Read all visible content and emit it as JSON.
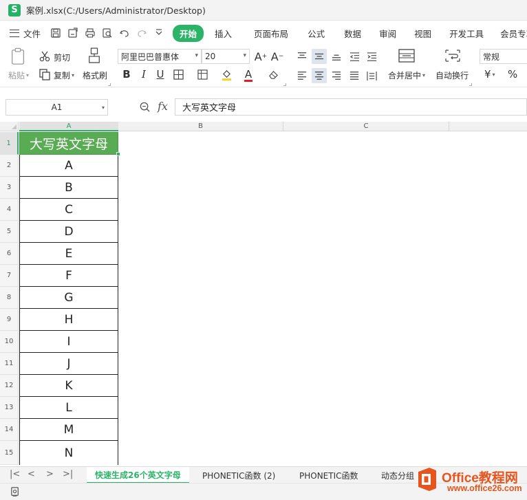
{
  "window": {
    "app_logo": "S",
    "title": "案例.xlsx(C:/Users/Administrator/Desktop)"
  },
  "menu": {
    "file_label": "文件",
    "quick_access_icons": [
      "save-icon",
      "save-as-icon",
      "print-icon",
      "print-preview-icon",
      "undo-icon",
      "redo-icon",
      "more-icon"
    ],
    "tabs": [
      "开始",
      "插入",
      "页面布局",
      "公式",
      "数据",
      "审阅",
      "视图",
      "开发工具",
      "会员专享"
    ],
    "active_tab": "开始"
  },
  "ribbon": {
    "paste_label": "粘贴",
    "cut_label": "剪切",
    "copy_label": "复制",
    "format_painter_label": "格式刷",
    "font_name": "阿里巴巴普惠体",
    "font_size": "20",
    "merge_center_label": "合并居中",
    "wrap_text_label": "自动换行",
    "number_format": "常规",
    "currency_symbol": "¥",
    "percent_symbol": "%",
    "bold": "B",
    "italic": "I",
    "underline": "U",
    "font_color_letter": "A",
    "increase_font": "A⁺",
    "decrease_font": "A⁻"
  },
  "formula_bar": {
    "cell_ref": "A1",
    "fx": "fx",
    "content": "大写英文字母"
  },
  "grid": {
    "columns": [
      "A",
      "B",
      "C"
    ],
    "rows": [
      "1",
      "2",
      "3",
      "4",
      "5",
      "6",
      "7",
      "8",
      "9",
      "10",
      "11",
      "12",
      "13",
      "14",
      "15"
    ],
    "column_a": [
      "大写英文字母",
      "A",
      "B",
      "C",
      "D",
      "E",
      "F",
      "G",
      "H",
      "I",
      "J",
      "K",
      "L",
      "M",
      "N"
    ],
    "header_fill": "#5aac54"
  },
  "sheet_tabs": {
    "nav": [
      "|<",
      "<",
      ">",
      ">|"
    ],
    "tabs": [
      "快速生成26个英文字母",
      "PHONETIC函数 (2)",
      "PHONETIC函数",
      "动态分组"
    ],
    "active": "快速生成26个英文字母"
  },
  "watermark": {
    "title": "Office教程网",
    "url": "www.office26.com"
  },
  "colors": {
    "accent": "#2bb468",
    "watermark": "#e8541e"
  }
}
